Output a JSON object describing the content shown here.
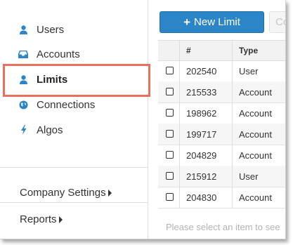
{
  "sidebar": {
    "items": [
      {
        "label": "Users",
        "icon": "user-icon"
      },
      {
        "label": "Accounts",
        "icon": "inbox-icon"
      },
      {
        "label": "Limits",
        "icon": "user-icon"
      },
      {
        "label": "Connections",
        "icon": "globe-icon"
      },
      {
        "label": "Algos",
        "icon": "bolt-icon"
      }
    ],
    "active_item": "Limits",
    "company_settings": "Company Settings",
    "reports": "Reports"
  },
  "toolbar": {
    "new_label": "New Limit",
    "secondary_label": "Co"
  },
  "table": {
    "columns": [
      "#",
      "Type"
    ],
    "rows": [
      {
        "id": "202540",
        "type": "User"
      },
      {
        "id": "215533",
        "type": "Account"
      },
      {
        "id": "198962",
        "type": "Account"
      },
      {
        "id": "199717",
        "type": "Account"
      },
      {
        "id": "204829",
        "type": "Account"
      },
      {
        "id": "215912",
        "type": "User"
      },
      {
        "id": "204830",
        "type": "Account"
      }
    ]
  },
  "hint": "Please select an item to see",
  "colors": {
    "accent": "#2c85c6",
    "highlight": "#e8705e",
    "icon": "#2c85c6"
  }
}
